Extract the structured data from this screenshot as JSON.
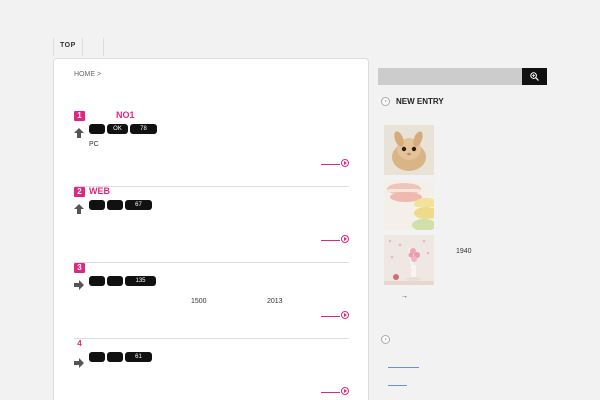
{
  "nav": {
    "tabs": [
      {
        "label": "TOP"
      },
      {
        "label": ""
      }
    ]
  },
  "breadcrumb": {
    "home": "HOME",
    "sep": ">"
  },
  "entries": [
    {
      "rank": "1",
      "title": "NO1",
      "trend": "up",
      "tags": [
        "",
        "OK",
        "78"
      ],
      "desc": "PC",
      "numbers": []
    },
    {
      "rank": "2",
      "title": "WEB",
      "trend": "up",
      "tags": [
        "",
        "",
        "67"
      ],
      "desc": "",
      "numbers": []
    },
    {
      "rank": "3",
      "title": "",
      "trend": "right",
      "tags": [
        "",
        "",
        "135"
      ],
      "desc": "",
      "numbers": [
        "1500",
        "2013"
      ]
    },
    {
      "rank": "4",
      "title": "",
      "trend": "right",
      "tags": [
        "",
        "",
        "61"
      ],
      "desc": "",
      "numbers": []
    }
  ],
  "search": {
    "placeholder": "",
    "value": ""
  },
  "sidebar": {
    "new_entry_heading": "NEW ENTRY",
    "items": [
      {
        "thumb": "bunny-photo",
        "text": ""
      },
      {
        "thumb": "macaron-photo",
        "text": ""
      },
      {
        "thumb": "pink-dessert-photo",
        "text": "1940"
      }
    ],
    "arrow_text": "→",
    "second_heading": ""
  },
  "colors": {
    "accent": "#e2267f",
    "tag_bg": "#111111",
    "link": "#6a8fd6",
    "page_bg": "#f2f2f2"
  }
}
